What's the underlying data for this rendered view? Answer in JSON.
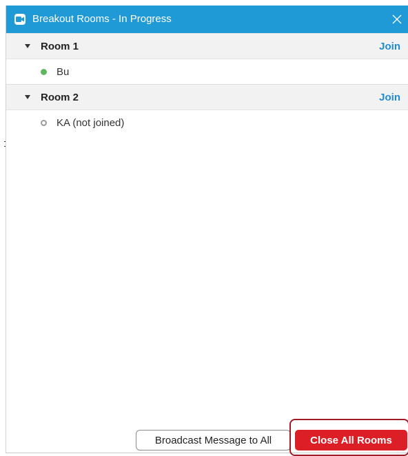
{
  "window": {
    "title": "Breakout Rooms - In Progress",
    "close_icon": "close-icon",
    "app_icon": "zoom-camera-icon"
  },
  "rooms": [
    {
      "name": "Room 1",
      "join_label": "Join",
      "participants": [
        {
          "name": "Bu",
          "status": "joined"
        }
      ]
    },
    {
      "name": "Room 2",
      "join_label": "Join",
      "participants": [
        {
          "name": "KA (not joined)",
          "status": "not-joined"
        }
      ]
    }
  ],
  "footer": {
    "broadcast_label": "Broadcast Message to All",
    "close_all_label": "Close All Rooms"
  },
  "colors": {
    "titlebar": "#1f9ad6",
    "join_link": "#1f8ad2",
    "close_all_button": "#dc1f26",
    "highlight_frame": "#a11b25",
    "joined_dot": "#5cb85c",
    "not_joined_dot": "#9a9a9a"
  }
}
